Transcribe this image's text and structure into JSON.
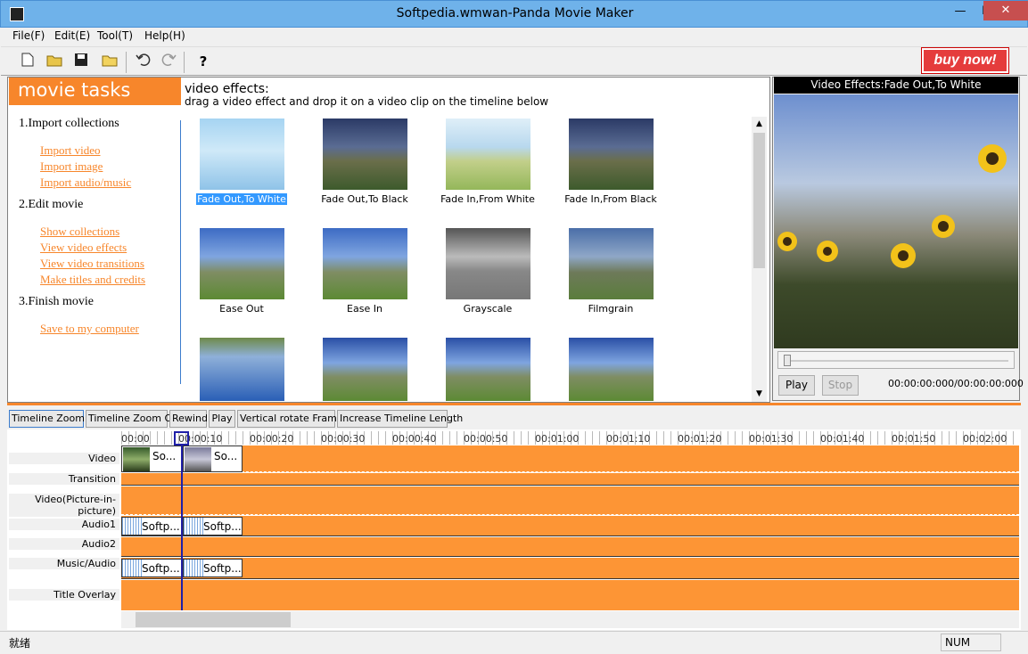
{
  "window": {
    "title": "Softpedia.wmwan-Panda Movie Maker",
    "minimize": "—",
    "maximize": "☐",
    "close": "✕"
  },
  "menu": [
    {
      "label": "File(F)"
    },
    {
      "label": "Edit(E)"
    },
    {
      "label": "Tool(T)"
    },
    {
      "label": "Help(H)"
    }
  ],
  "toolbar": {
    "icons": [
      "new-icon",
      "open-icon",
      "save-icon",
      "folder-icon",
      "undo-icon",
      "redo-icon",
      "help-icon"
    ],
    "buy_label": "buy now!"
  },
  "tasks": {
    "header": "movie tasks",
    "sections": [
      {
        "title": "1.Import collections",
        "links": [
          "Import video",
          "Import image",
          "Import audio/music"
        ]
      },
      {
        "title": "2.Edit movie",
        "links": [
          "Show collections",
          "View video effects",
          "View video transitions",
          "Make titles and credits"
        ]
      },
      {
        "title": "3.Finish movie",
        "links": [
          "Save to my computer"
        ]
      }
    ]
  },
  "effects": {
    "title": "video effects:",
    "subtitle": "drag a video effect and drop it on a video clip on the timeline below",
    "items": [
      "Fade Out,To White",
      "Fade Out,To Black",
      "Fade In,From White",
      "Fade In,From Black",
      "Ease Out",
      "Ease In",
      "Grayscale",
      "Filmgrain",
      "",
      "",
      "",
      ""
    ],
    "selected": "Fade Out,To White"
  },
  "preview": {
    "header": "Video Effects:Fade Out,To White",
    "play": "Play",
    "stop": "Stop",
    "time": "00:00:00:000/00:00:00:000"
  },
  "timeline": {
    "buttons": [
      "Timeline Zoom In",
      "Timeline Zoom Out",
      "Rewind",
      "Play",
      "Vertical rotate Frame",
      "Increase Timeline Length"
    ],
    "ticks": [
      "00:00",
      "00:00:10",
      "00:00:20",
      "00:00:30",
      "00:00:40",
      "00:00:50",
      "00:01:00",
      "00:01:10",
      "00:01:20",
      "00:01:30",
      "00:01:40",
      "00:01:50",
      "00:02:00"
    ],
    "tracks": [
      "Video",
      "Transition",
      "Video(Picture-in-picture)",
      "Audio1",
      "Audio2",
      "Music/Audio",
      "Title Overlay"
    ],
    "video_clips": [
      "So...",
      "So..."
    ],
    "audio1_clips": [
      "Softp...",
      "Softp..."
    ],
    "music_clips": [
      "Softp...",
      "Softp..."
    ]
  },
  "status": {
    "left": "就绪",
    "num": "NUM"
  },
  "colors": {
    "accent": "#f7862b",
    "track": "#fd9535",
    "playhead": "#1f1fa8"
  }
}
